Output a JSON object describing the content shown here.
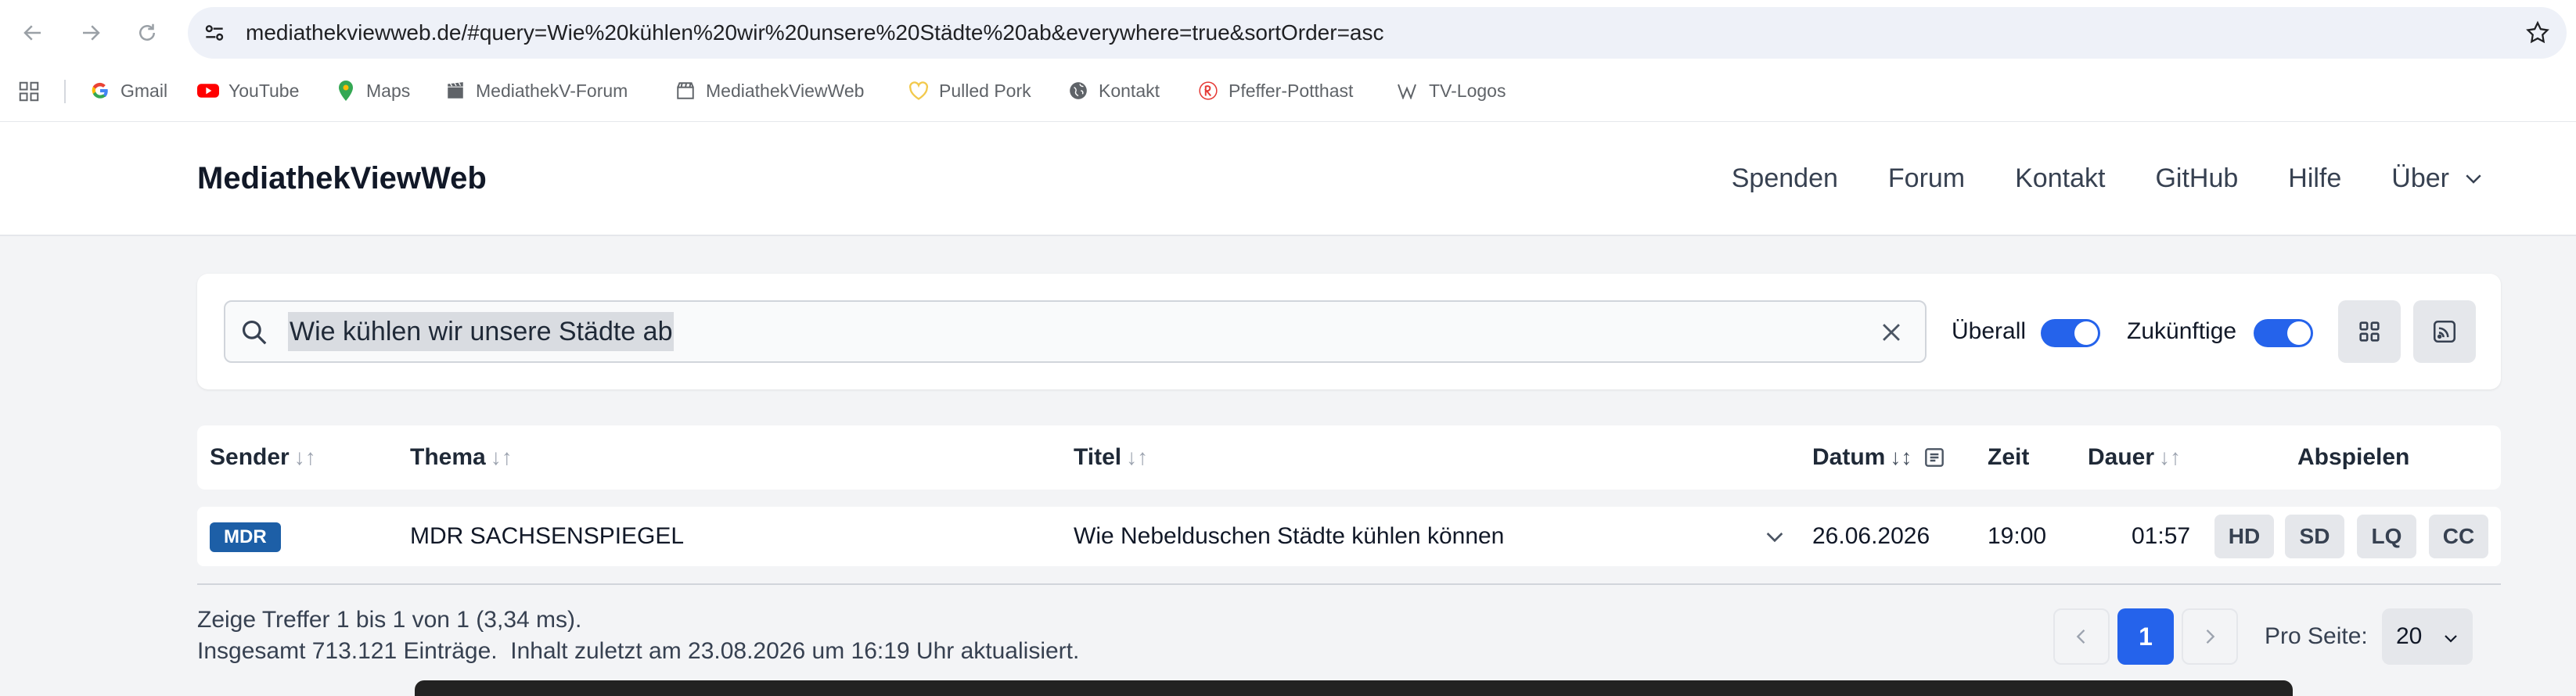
{
  "browser": {
    "url": "mediathekviewweb.de/#query=Wie%20kühlen%20wir%20unsere%20Städte%20ab&everywhere=true&sortOrder=asc",
    "bookmarks": [
      "Gmail",
      "YouTube",
      "Maps",
      "MediathekV-Forum",
      "MediathekViewWeb",
      "Pulled Pork",
      "Kontakt",
      "Pfeffer-Potthast",
      "TV-Logos"
    ]
  },
  "header": {
    "brand": "MediathekViewWeb",
    "nav": [
      "Spenden",
      "Forum",
      "Kontakt",
      "GitHub",
      "Hilfe",
      "Über"
    ]
  },
  "search": {
    "value": "Wie kühlen wir unsere Städte ab",
    "toggle_everywhere": "Überall",
    "toggle_future": "Zukünftige",
    "everywhere_on": true,
    "future_on": true
  },
  "table": {
    "headers": {
      "sender": "Sender",
      "thema": "Thema",
      "titel": "Titel",
      "datum": "Datum",
      "zeit": "Zeit",
      "dauer": "Dauer",
      "abspielen": "Abspielen"
    },
    "rows": [
      {
        "sender": "MDR",
        "thema": "MDR SACHSENSPIEGEL",
        "titel": "Wie Nebelduschen Städte kühlen können",
        "datum": "26.06.2026",
        "zeit": "19:00",
        "dauer": "01:57",
        "qualities": [
          "HD",
          "SD",
          "LQ",
          "CC"
        ]
      }
    ]
  },
  "footer": {
    "hits": "Zeige Treffer 1 bis 1 von 1 (3,34 ms).",
    "total": "Insgesamt 713.121 Einträge.  Inhalt zuletzt am 23.08.2026 um 16:19 Uhr aktualisiert.",
    "current_page": "1",
    "per_page_label": "Pro Seite:",
    "per_page_value": "20"
  },
  "colors": {
    "accent": "#2563eb",
    "mdr_badge": "#1d5fa7"
  }
}
